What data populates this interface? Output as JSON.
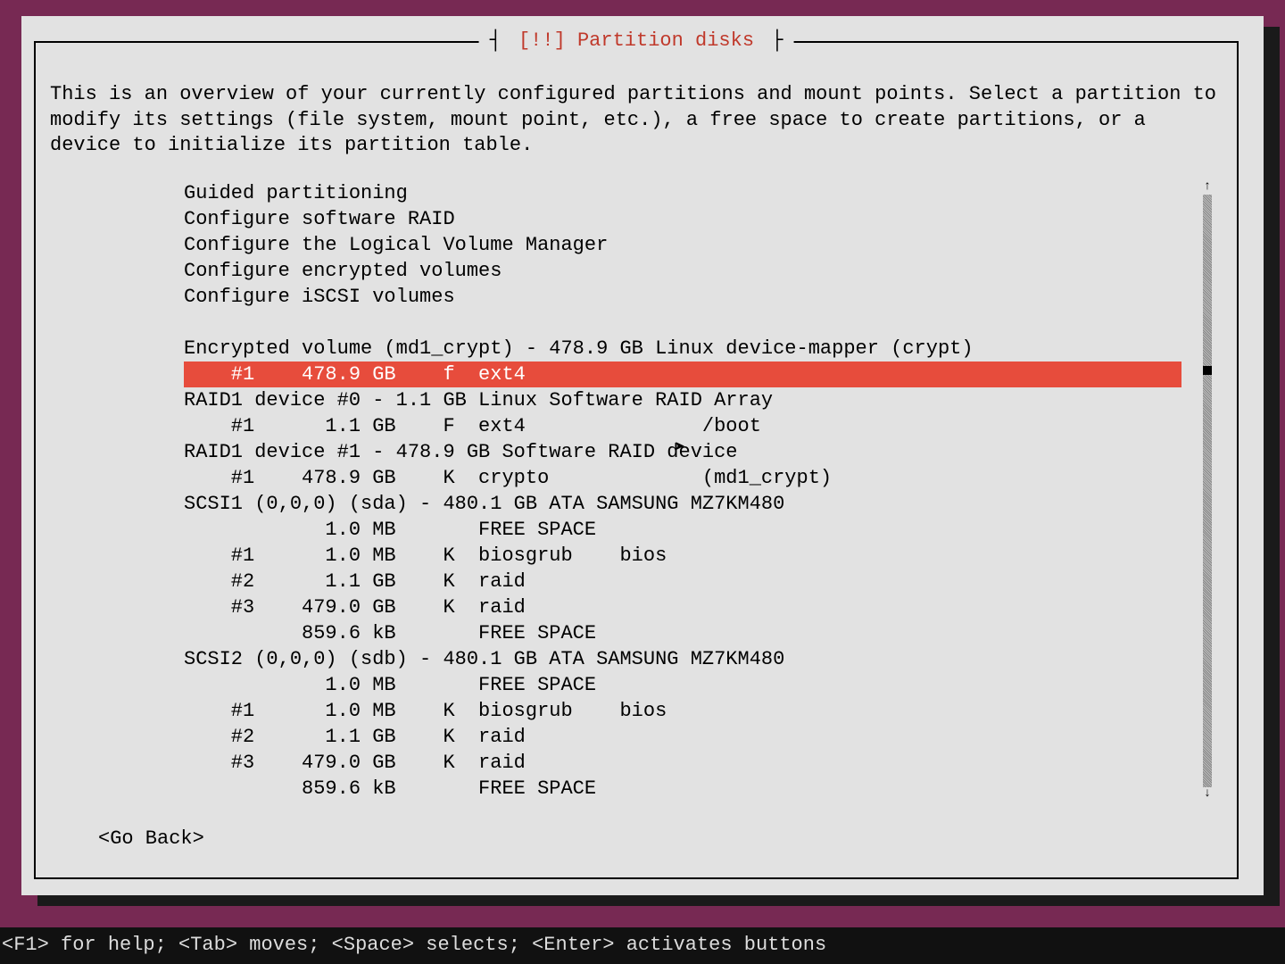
{
  "dialog": {
    "title_prefix": "[!!]",
    "title": "Partition disks",
    "intro": "This is an overview of your currently configured partitions and mount points. Select a partition to modify its settings (file system, mount point, etc.), a free space to create partitions, or a device to initialize its partition table."
  },
  "menu": {
    "config_items": [
      "Guided partitioning",
      "Configure software RAID",
      "Configure the Logical Volume Manager",
      "Configure encrypted volumes",
      "Configure iSCSI volumes"
    ],
    "entries": [
      {
        "text": "Encrypted volume (md1_crypt) - 478.9 GB Linux device-mapper (crypt)",
        "selected": false,
        "indent": 0
      },
      {
        "text": "    #1    478.9 GB    f  ext4",
        "selected": true,
        "indent": 0
      },
      {
        "text": "RAID1 device #0 - 1.1 GB Linux Software RAID Array",
        "selected": false,
        "indent": 0
      },
      {
        "text": "    #1      1.1 GB    F  ext4               /boot",
        "selected": false,
        "indent": 0
      },
      {
        "text": "RAID1 device #1 - 478.9 GB Software RAID device",
        "selected": false,
        "indent": 0
      },
      {
        "text": "    #1    478.9 GB    K  crypto             (md1_crypt)",
        "selected": false,
        "indent": 0
      },
      {
        "text": "SCSI1 (0,0,0) (sda) - 480.1 GB ATA SAMSUNG MZ7KM480",
        "selected": false,
        "indent": 0
      },
      {
        "text": "            1.0 MB       FREE SPACE",
        "selected": false,
        "indent": 0
      },
      {
        "text": "    #1      1.0 MB    K  biosgrub    bios",
        "selected": false,
        "indent": 0
      },
      {
        "text": "    #2      1.1 GB    K  raid",
        "selected": false,
        "indent": 0
      },
      {
        "text": "    #3    479.0 GB    K  raid",
        "selected": false,
        "indent": 0
      },
      {
        "text": "          859.6 kB       FREE SPACE",
        "selected": false,
        "indent": 0
      },
      {
        "text": "SCSI2 (0,0,0) (sdb) - 480.1 GB ATA SAMSUNG MZ7KM480",
        "selected": false,
        "indent": 0
      },
      {
        "text": "            1.0 MB       FREE SPACE",
        "selected": false,
        "indent": 0
      },
      {
        "text": "    #1      1.0 MB    K  biosgrub    bios",
        "selected": false,
        "indent": 0
      },
      {
        "text": "    #2      1.1 GB    K  raid",
        "selected": false,
        "indent": 0
      },
      {
        "text": "    #3    479.0 GB    K  raid",
        "selected": false,
        "indent": 0
      },
      {
        "text": "          859.6 kB       FREE SPACE",
        "selected": false,
        "indent": 0
      }
    ]
  },
  "go_back": "<Go Back>",
  "footer": "<F1> for help; <Tab> moves; <Space> selects; <Enter> activates buttons"
}
